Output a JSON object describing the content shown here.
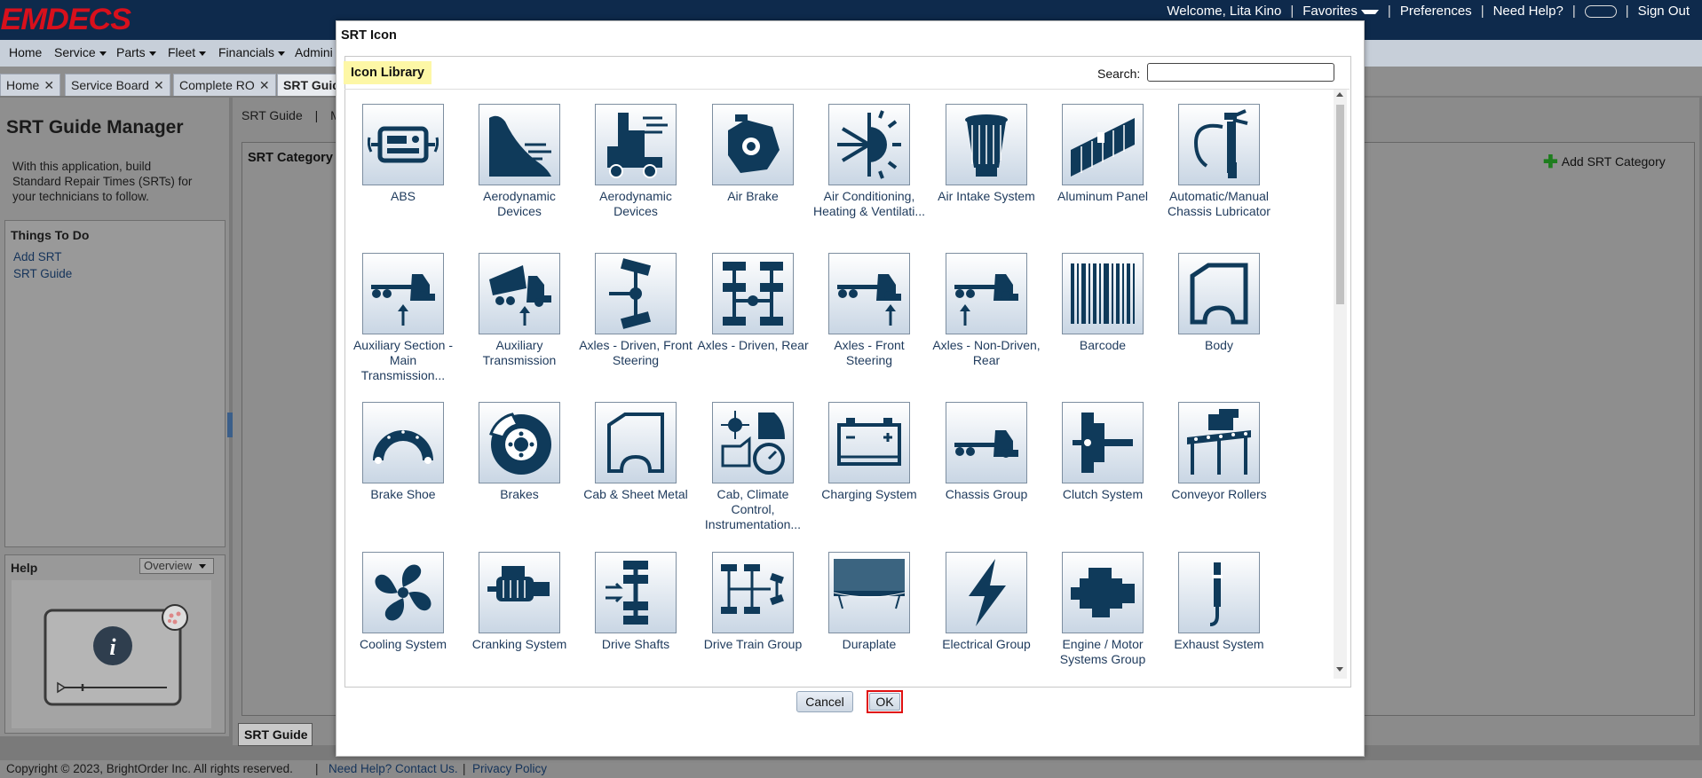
{
  "brand": {
    "logo": "EMDECS"
  },
  "header": {
    "welcome": "Welcome, Lita Kino",
    "favorites": "Favorites",
    "preferences": "Preferences",
    "need_help": "Need Help?",
    "sign_out": "Sign Out"
  },
  "menu": [
    "Home",
    "Service",
    "Parts",
    "Fleet",
    "Financials",
    "Admini"
  ],
  "tabs": [
    "Home",
    "Service Board",
    "Complete RO",
    "SRT Guid"
  ],
  "left": {
    "title": "SRT Guide Manager",
    "description": "With this application, build Standard Repair Times (SRTs) for your technicians to follow.",
    "things_to_do": "Things To Do",
    "todo_links": [
      "Add SRT",
      "SRT Guide"
    ],
    "help_title": "Help",
    "help_select": "Overview"
  },
  "main": {
    "tab_srt_guide": "SRT Guide",
    "tab_sep": "|",
    "tab_m": "M",
    "category_title": "SRT Category",
    "add_category": "Add SRT Category",
    "bottom_tab": "SRT Guide"
  },
  "footer": {
    "copyright": "Copyright © 2023, BrightOrder Inc. All rights reserved.",
    "contact": "Need Help? Contact Us.",
    "privacy": "Privacy Policy"
  },
  "modal": {
    "title": "SRT Icon",
    "library_tab": "Icon Library",
    "search_label": "Search:",
    "search_value": "",
    "cancel": "Cancel",
    "ok": "OK",
    "icons": [
      {
        "label": "ABS",
        "icon": "abs-icon"
      },
      {
        "label": "Aerodynamic Devices",
        "icon": "aero-fairing-icon"
      },
      {
        "label": "Aerodynamic Devices",
        "icon": "aero-truck-icon"
      },
      {
        "label": "Air Brake",
        "icon": "air-brake-icon"
      },
      {
        "label": "Air Conditioning, Heating & Ventilati...",
        "icon": "hvac-icon"
      },
      {
        "label": "Air Intake System",
        "icon": "air-filter-icon"
      },
      {
        "label": "Aluminum Panel",
        "icon": "aluminum-panel-icon"
      },
      {
        "label": "Automatic/Manual Chassis Lubricator",
        "icon": "grease-gun-icon"
      },
      {
        "label": "Auxiliary Section - Main Transmission...",
        "icon": "truck-aux-icon"
      },
      {
        "label": "Auxiliary Transmission",
        "icon": "dump-truck-icon"
      },
      {
        "label": "Axles - Driven, Front Steering",
        "icon": "axle-front-icon"
      },
      {
        "label": "Axles - Driven, Rear",
        "icon": "axle-rear-icon"
      },
      {
        "label": "Axles - Front Steering",
        "icon": "truck-front-axle-icon"
      },
      {
        "label": "Axles - Non-Driven, Rear",
        "icon": "truck-rear-axle-icon"
      },
      {
        "label": "Barcode",
        "icon": "barcode-icon"
      },
      {
        "label": "Body",
        "icon": "body-panel-icon"
      },
      {
        "label": "Brake Shoe",
        "icon": "brake-shoe-icon"
      },
      {
        "label": "Brakes",
        "icon": "brake-rotor-icon"
      },
      {
        "label": "Cab & Sheet Metal",
        "icon": "cab-sheet-icon"
      },
      {
        "label": "Cab, Climate Control, Instrumentation...",
        "icon": "cab-climate-icon"
      },
      {
        "label": "Charging System",
        "icon": "battery-icon"
      },
      {
        "label": "Chassis Group",
        "icon": "chassis-truck-icon"
      },
      {
        "label": "Clutch System",
        "icon": "clutch-icon"
      },
      {
        "label": "Conveyor Rollers",
        "icon": "conveyor-icon"
      },
      {
        "label": "Cooling System",
        "icon": "fan-icon"
      },
      {
        "label": "Cranking System",
        "icon": "starter-icon"
      },
      {
        "label": "Drive Shafts",
        "icon": "driveshaft-icon"
      },
      {
        "label": "Drive Train Group",
        "icon": "drivetrain-icon"
      },
      {
        "label": "Duraplate",
        "icon": "duraplate-icon"
      },
      {
        "label": "Electrical Group",
        "icon": "lightning-icon"
      },
      {
        "label": "Engine / Motor Systems Group",
        "icon": "engine-icon"
      },
      {
        "label": "Exhaust System",
        "icon": "exhaust-icon"
      }
    ]
  },
  "colors": {
    "topbar": "#0e2a4c",
    "logo": "#d8101c",
    "icon_fill": "#0f3a5a",
    "library_tab_highlight": "#fdf7a6",
    "ok_outline": "#e01010"
  }
}
